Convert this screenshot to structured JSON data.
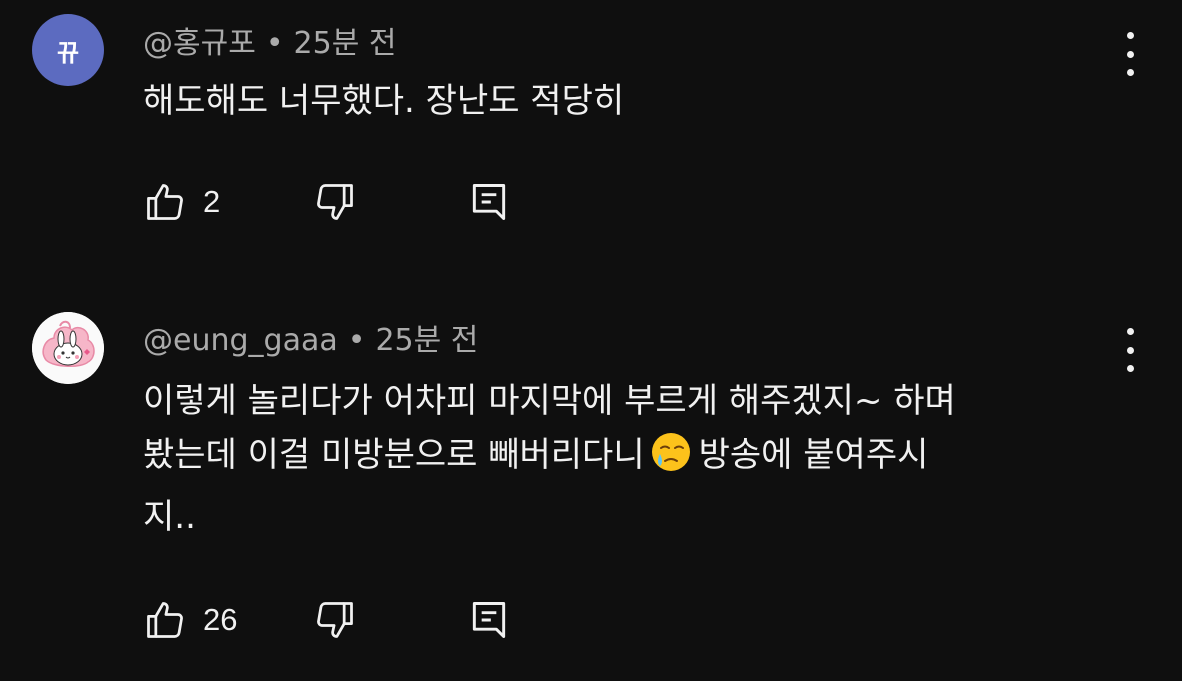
{
  "comments": [
    {
      "avatar_letter": "뀨",
      "avatar_color": "#5c6bc0",
      "author": "@홍규포",
      "separator": "•",
      "time": "25분 전",
      "text_lines": [
        "해도해도 너무했다. 장난도 적당히"
      ],
      "likes": "2"
    },
    {
      "avatar_icon": "bunny-avatar-icon",
      "author": "@eung_gaaa",
      "separator": "•",
      "time": "25분 전",
      "text_lines": [
        "이렇게 놀리다가 어차피 마지막에 부르게 해주겠지~ 하며",
        "봤는데 이걸 미방분으로 빼버리다니",
        "방송에 붙여주시",
        "지.."
      ],
      "emoji": "face-holding-back-tears-icon",
      "likes": "26"
    }
  ],
  "colors": {
    "background": "#0f0f0f",
    "text": "#f1f1f1",
    "meta": "#aaaaaa"
  }
}
